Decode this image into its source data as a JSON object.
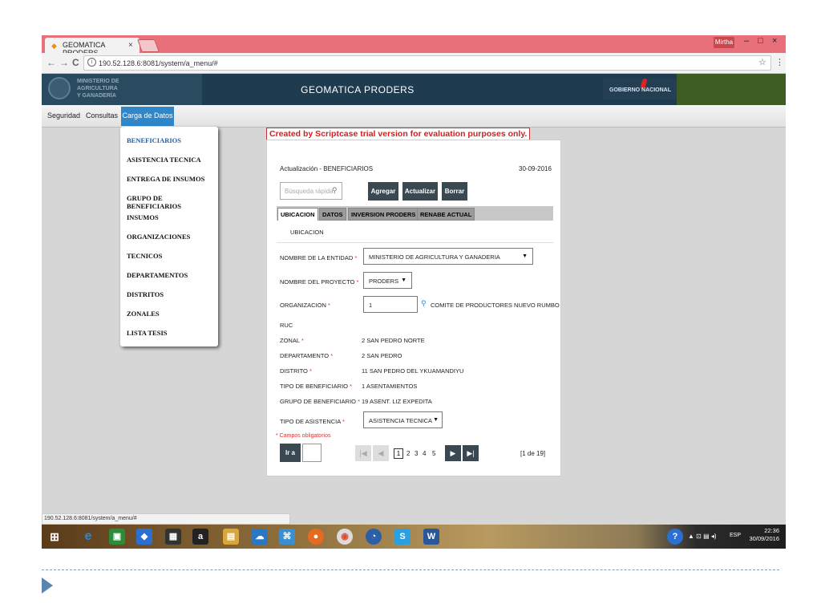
{
  "browser": {
    "tab_title": "GEOMATICA PRODERS",
    "tab_close": "×",
    "user_badge": "Mirtha",
    "window_controls": [
      "–",
      "□",
      "×"
    ],
    "nav": {
      "back": "←",
      "forward": "→",
      "reload": "C"
    },
    "url": "190.52.128.6:8081/system/a_menu/#",
    "star": "☆",
    "menu_dots": "⋮"
  },
  "header": {
    "ministry_lines": [
      "MINISTERIO DE",
      "AGRICULTURA",
      "Y GANADERÍA"
    ],
    "title": "GEOMATICA PRODERS",
    "gov_label": "GOBIERNO NACIONAL"
  },
  "menubar": {
    "items": [
      "Seguridad",
      "Consultas",
      "Carga de Datos"
    ]
  },
  "dropdown": {
    "items": [
      "BENEFICIARIOS",
      "ASISTENCIA TECNICA",
      "ENTREGA DE INSUMOS",
      "GRUPO DE BENEFICIARIOS",
      "INSUMOS",
      "ORGANIZACIONES",
      "TECNICOS",
      "DEPARTAMENTOS",
      "DISTRITOS",
      "ZONALES",
      "LISTA TESIS"
    ],
    "active_color": "#1f5fa8"
  },
  "form": {
    "trial_notice": "Created by Scriptcase trial version for evaluation purposes only.",
    "heading": "Actualización - BENEFICIARIOS",
    "date": "30-09-2016",
    "search_placeholder": "Búsqueda rápida",
    "buttons": {
      "add": "Agregar",
      "update": "Actualizar",
      "delete": "Borrar"
    },
    "tabs": [
      "UBICACION",
      "DATOS",
      "INVERSION PRODERS",
      "RENABE ACTUAL"
    ],
    "section": "UBICACION",
    "fields": {
      "entidad_label": "NOMBRE DE LA ENTIDAD",
      "entidad_value": "MINISTERIO DE AGRICULTURA Y GANADERIA",
      "proyecto_label": "NOMBRE DEL PROYECTO",
      "proyecto_value": "PRODERS",
      "organizacion_label": "ORGANIZACION",
      "organizacion_value": "1",
      "organizacion_desc": "COMITE DE PRODUCTORES NUEVO RUMBO",
      "ruc_label": "RUC",
      "zonal_label": "ZONAL",
      "zonal_value": "2 SAN PEDRO NORTE",
      "departamento_label": "DEPARTAMENTO",
      "departamento_value": "2 SAN PEDRO",
      "distrito_label": "DISTRITO",
      "distrito_value": "11 SAN PEDRO DEL YKUAMANDIYU",
      "tipo_benef_label": "TIPO DE BENEFICIARIO",
      "tipo_benef_value": "1 ASENTAMIENTOS",
      "grupo_label": "GRUPO DE BENEFICIARIO",
      "grupo_value": "19 ASENT. LIZ EXPEDITA",
      "asistencia_label": "TIPO DE ASISTENCIA",
      "asistencia_value": "ASISTENCIA TECNICA"
    },
    "required_mark": "*",
    "required_note": "* Campos obligatorios",
    "goto_label": "Ir a",
    "pages": [
      "1",
      "2",
      "3",
      "4",
      "5"
    ],
    "record_count": "[1 de 19]"
  },
  "statusbar": {
    "text": "190.52.128.6:8081/system/a_menu/#"
  },
  "taskbar": {
    "tray_lang": "ESP",
    "time": "22:36",
    "date": "30/09/2016",
    "help": "?"
  }
}
